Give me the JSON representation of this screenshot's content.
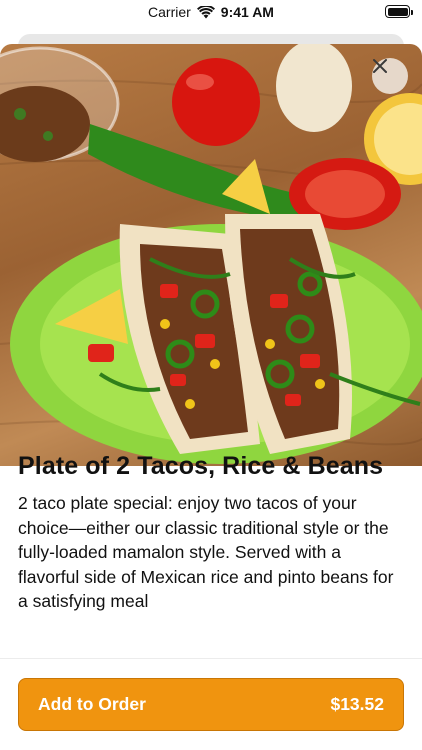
{
  "status_bar": {
    "carrier": "Carrier",
    "time": "9:41 AM"
  },
  "hero": {
    "image": "tacos-plate-photo"
  },
  "item": {
    "title": "Plate of 2 Tacos, Rice & Beans",
    "description": "2 taco plate special: enjoy two tacos of your choice—either our classic traditional style or the fully-loaded mamalon style. Served with a flavorful side of Mexican rice and pinto beans for a satisfying meal"
  },
  "order_button": {
    "label": "Add to Order",
    "price": "$13.52"
  },
  "colors": {
    "accent": "#f0940f",
    "accent_border": "#c97605",
    "close_bg": "#ece2d7"
  },
  "icons": {
    "close": "close-icon",
    "wifi": "wifi-icon",
    "battery": "battery-icon"
  }
}
